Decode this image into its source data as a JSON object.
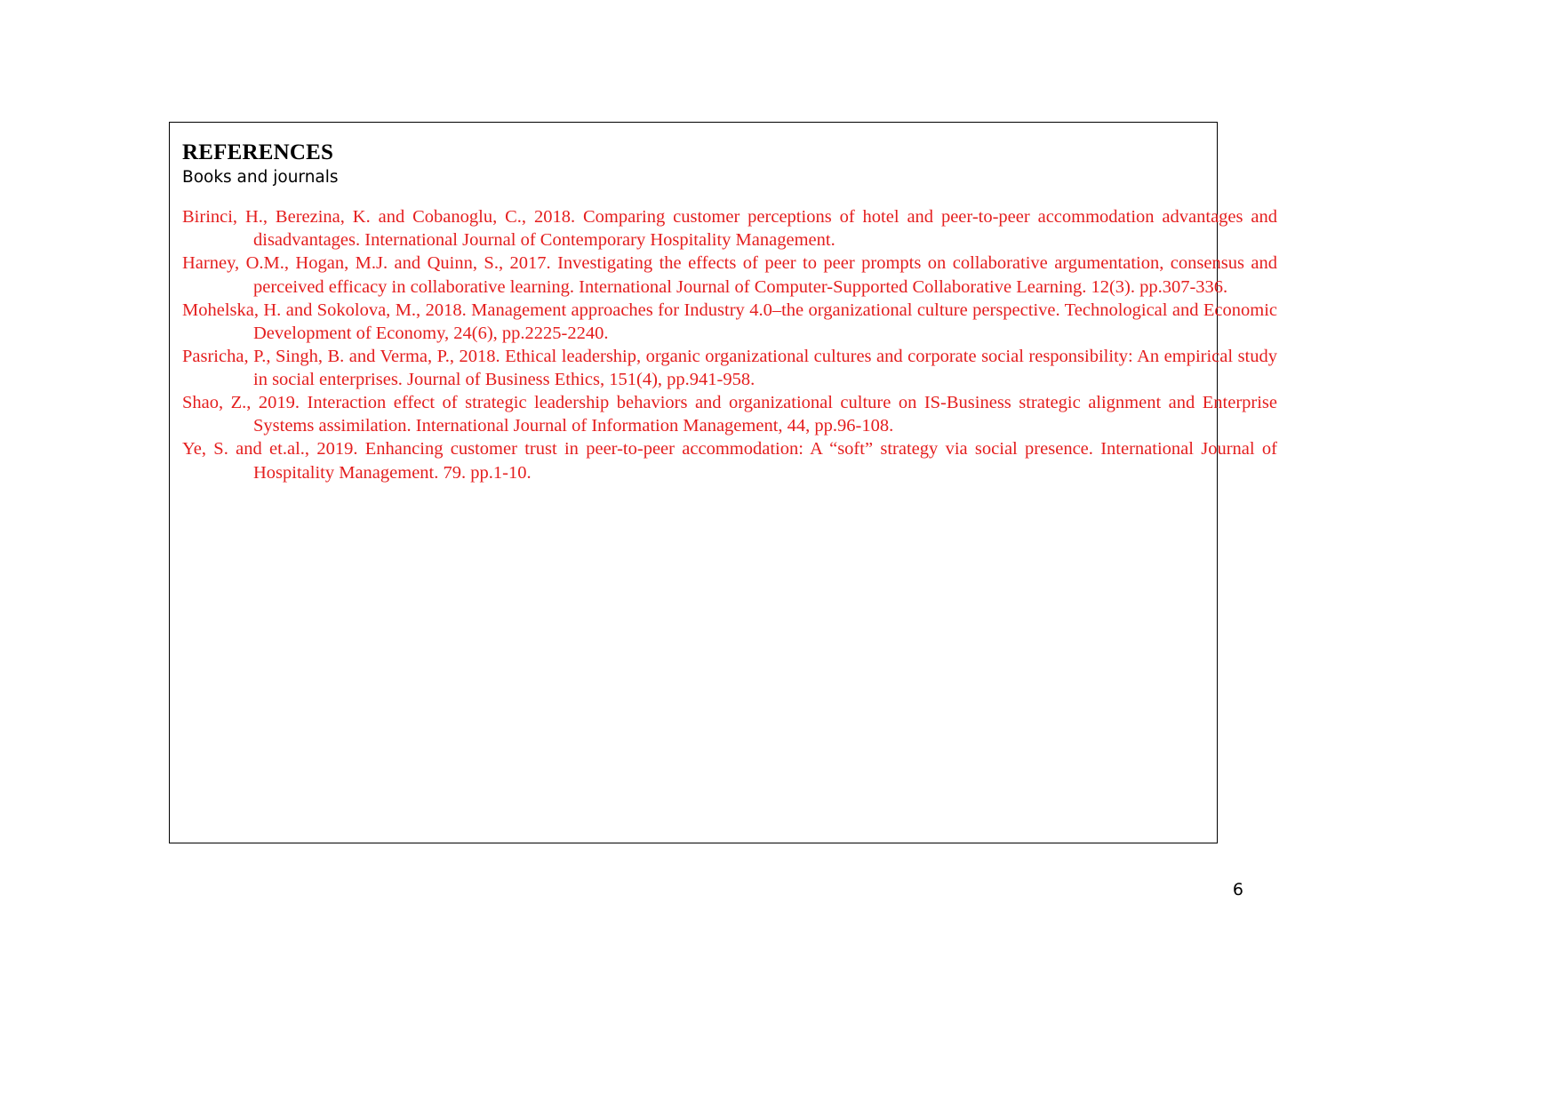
{
  "document": {
    "page_number": "6",
    "accent_color": "#E41E1E",
    "text_color": "#000000"
  },
  "heading": {
    "title": "REFERENCES",
    "subtitle": "Books and journals"
  },
  "references": [
    {
      "id": "birinci-2018",
      "text": "Birinci, H., Berezina, K. and Cobanoglu, C., 2018. Comparing customer perceptions of hotel and peer-to-peer accommodation advantages and disadvantages. International Journal of Contemporary Hospitality Management."
    },
    {
      "id": "harney-2017",
      "text": "Harney, O.M., Hogan, M.J. and Quinn, S., 2017. Investigating the effects of peer to peer prompts on collaborative argumentation, consensus and perceived efficacy in collaborative learning. International Journal of Computer-Supported Collaborative Learning. 12(3). pp.307-336."
    },
    {
      "id": "mohelska-2018",
      "text": "Mohelska, H. and Sokolova, M., 2018. Management approaches for Industry 4.0–the organizational culture perspective. Technological and Economic Development of Economy, 24(6), pp.2225-2240."
    },
    {
      "id": "pasricha-2018",
      "text": "Pasricha, P., Singh, B. and Verma, P., 2018. Ethical leadership, organic organizational cultures and corporate social responsibility: An empirical study in social enterprises. Journal of Business Ethics, 151(4), pp.941-958."
    },
    {
      "id": "shao-2019",
      "text": "Shao, Z., 2019. Interaction effect of strategic leadership behaviors and organizational culture on IS-Business strategic alignment and Enterprise Systems assimilation. International Journal of Information Management, 44, pp.96-108."
    },
    {
      "id": "ye-2019",
      "text": "Ye, S. and et.al., 2019. Enhancing customer trust in peer-to-peer accommodation: A “soft” strategy via social presence. International Journal of Hospitality Management. 79. pp.1-10."
    }
  ]
}
